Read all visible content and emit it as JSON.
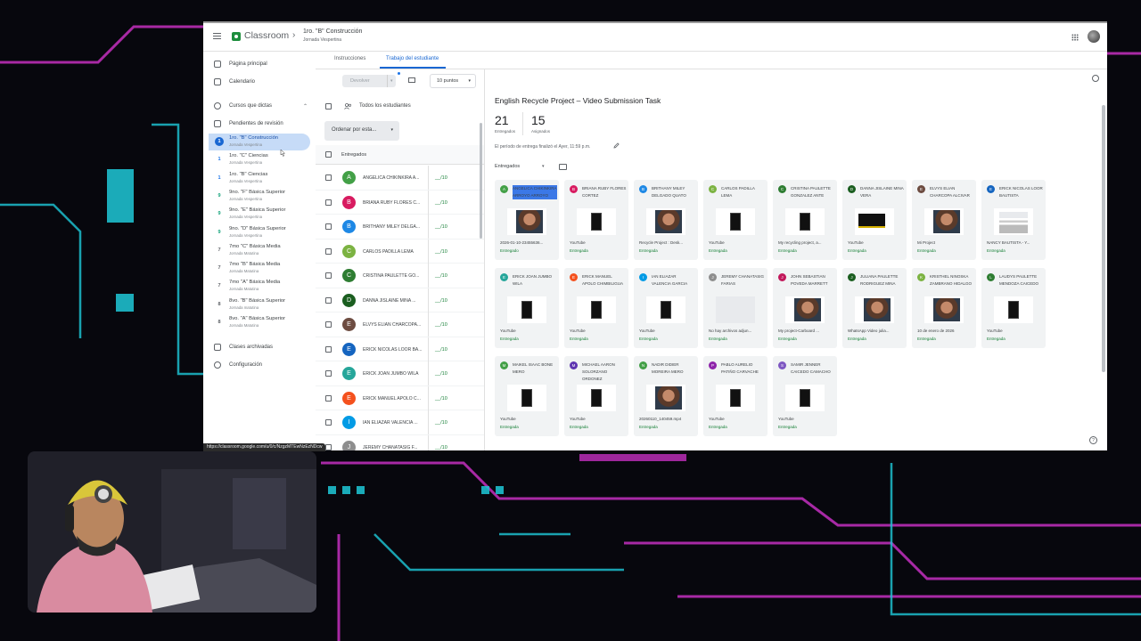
{
  "header": {
    "app_name": "Classroom",
    "course_title": "1ro. \"B\" Construcción",
    "course_subtitle": "Jornada Vespertina"
  },
  "sidebar": {
    "main_items": [
      {
        "label": "Página principal",
        "icon": "home-icon"
      },
      {
        "label": "Calendario",
        "icon": "calendar-icon"
      }
    ],
    "teaching_label": "Cursos que dictas",
    "review_label": "Pendientes de revisión",
    "courses": [
      {
        "num": "1",
        "name": "1ro. \"B\" Construcción",
        "sub": "Jornada Vespertina",
        "color": "#1a73e8"
      },
      {
        "num": "1",
        "name": "1ro. \"C\" Ciencias",
        "sub": "Jornada Vespertina",
        "color": "#1a73e8"
      },
      {
        "num": "1",
        "name": "1ro. \"B\" Ciencias",
        "sub": "Jornada Vespertina",
        "color": "#1a73e8"
      },
      {
        "num": "9",
        "name": "9no. \"F\" Básica Superior",
        "sub": "Jornada Vespertina",
        "color": "#12a37a"
      },
      {
        "num": "9",
        "name": "9no. \"E\" Básica Superior",
        "sub": "Jornada Vespertina",
        "color": "#12a37a"
      },
      {
        "num": "9",
        "name": "9no. \"D\" Básica Superior",
        "sub": "Jornada Vespertina",
        "color": "#12a37a"
      },
      {
        "num": "7",
        "name": "7mo \"C\" Básica Media",
        "sub": "Jornada Matutina",
        "color": "#5f6368"
      },
      {
        "num": "7",
        "name": "7mo \"B\" Básica Media",
        "sub": "Jornada Matutina",
        "color": "#5f6368"
      },
      {
        "num": "7",
        "name": "7mo \"A\" Básica Media",
        "sub": "Jornada Matutina",
        "color": "#5f6368"
      },
      {
        "num": "8",
        "name": "8vo. \"B\" Básica Superior",
        "sub": "Jornada matutina",
        "color": "#5f6368"
      },
      {
        "num": "8",
        "name": "8vo. \"A\" Básica Superior",
        "sub": "Jornada Matutina",
        "color": "#5f6368"
      }
    ],
    "archived_label": "Clases archivadas",
    "settings_label": "Configuración"
  },
  "tabs": [
    {
      "label": "Instrucciones"
    },
    {
      "label": "Trabajo del estudiante"
    }
  ],
  "toolbar": {
    "return_label": "Devolver",
    "points_label": "10 puntos"
  },
  "student_list": {
    "all_students_label": "Todos los estudiantes",
    "sort_label": "Ordenar por esta...",
    "section_label": "Entregados",
    "grade_placeholder": "__/10",
    "students": [
      {
        "initial": "A",
        "name": "ANGELICA CHIKINKIRA A...",
        "color": "#43a047"
      },
      {
        "initial": "B",
        "name": "BRIANA RUBY FLORES C...",
        "color": "#d81b60"
      },
      {
        "initial": "B",
        "name": "BRITHANY MILEY DELGA...",
        "color": "#1e88e5"
      },
      {
        "initial": "C",
        "name": "CARLOS PADILLA LEMA",
        "color": "#7cb342"
      },
      {
        "initial": "C",
        "name": "CRISTINA PAULETTE GO...",
        "color": "#2e7d32"
      },
      {
        "initial": "D",
        "name": "DANNA JISLAINE MINA ...",
        "color": "#1b5e20"
      },
      {
        "initial": "E",
        "name": "ELVYS ELIAN CHARCOPA...",
        "color": "#6d4c41"
      },
      {
        "initial": "E",
        "name": "ERICK NICOLAS LOOR BA...",
        "color": "#1565c0"
      },
      {
        "initial": "E",
        "name": "ERICK JOAN JUMBO WILA",
        "color": "#26a69a"
      },
      {
        "initial": "E",
        "name": "ERICK MANUEL APOLO C...",
        "color": "#f4511e"
      },
      {
        "initial": "I",
        "name": "IAN ELIAZAR VALENCIA ...",
        "color": "#039be5"
      },
      {
        "initial": "J",
        "name": "JEREMY CHANATASIG F...",
        "color": "#8e8e8e"
      }
    ]
  },
  "assignment": {
    "title": "English Recycle Project – Video Submission Task",
    "submitted_count": "21",
    "submitted_label": "Entregados",
    "assigned_count": "15",
    "assigned_label": "Asignados",
    "deadline_text": "El período de entrega finalizó el Ayer, 11:59 p.m.",
    "filter_label": "Entregados"
  },
  "submissions": [
    {
      "initial": "A",
      "name": "ANGELICA CHIKINKIRA ARROYO ARROYO",
      "file": "2026-01-10-23455636...",
      "status": "Entregado",
      "color": "#43a047",
      "thumb": "photo"
    },
    {
      "initial": "B",
      "name": "BRIANA RUBY FLORES CORTEZ",
      "file": "YouTube",
      "status": "Entregada",
      "color": "#d81b60",
      "thumb": "phone"
    },
    {
      "initial": "B",
      "name": "BRITHANY MILEY DELGADO QUATO",
      "file": "Recycle Project : Desk...",
      "status": "Entregada",
      "color": "#1e88e5",
      "thumb": "photo"
    },
    {
      "initial": "C",
      "name": "CARLOS PADILLA LEMA",
      "file": "YouTube",
      "status": "Entregada",
      "color": "#7cb342",
      "thumb": "phone"
    },
    {
      "initial": "C",
      "name": "CRISTINA PAULETTE GONZALEZ ANTE",
      "file": "My recycling project, a...",
      "status": "Entregada",
      "color": "#2e7d32",
      "thumb": "phone"
    },
    {
      "initial": "D",
      "name": "DANNA JISLAINE MINA VERA",
      "file": "YouTube",
      "status": "Entregada",
      "color": "#1b5e20",
      "thumb": "dark"
    },
    {
      "initial": "E",
      "name": "ELVYS ELIAN CHARCOPA ALCIVAR",
      "file": "Mi Project",
      "status": "Entregada",
      "color": "#6d4c41",
      "thumb": "photo"
    },
    {
      "initial": "E",
      "name": "ERICK NICOLAS LOOR BAUTISTA",
      "file": "NANCY BAUTISTA - Y...",
      "status": "Entregada",
      "color": "#1565c0",
      "thumb": "doc"
    },
    {
      "initial": "E",
      "name": "ERICK JOAN JUMBO WILA",
      "file": "YouTube",
      "status": "Entregada",
      "color": "#26a69a",
      "thumb": "phone"
    },
    {
      "initial": "E",
      "name": "ERICK MANUEL APOLO CHIMBILIGUA",
      "file": "YouTube",
      "status": "Entregada",
      "color": "#f4511e",
      "thumb": "phone"
    },
    {
      "initial": "I",
      "name": "IAN ELIAZAR VALENCIA GARCIA",
      "file": "YouTube",
      "status": "Entregada",
      "color": "#039be5",
      "thumb": "phone"
    },
    {
      "initial": "J",
      "name": "JEREMY CHANATASIG FARIAS",
      "file": "No hay archivos adjun...",
      "status": "Entregada",
      "color": "#8e8e8e",
      "thumb": "empty"
    },
    {
      "initial": "J",
      "name": "JOHN SEBASTIAN POVEDA MARRETT",
      "file": "My project-Carboard ...",
      "status": "Entregada",
      "color": "#c2185b",
      "thumb": "photo"
    },
    {
      "initial": "J",
      "name": "JULIANA PAULETTE RODRIGUEZ MINA",
      "file": "WhatsApp Video julia...",
      "status": "Entregada",
      "color": "#1b5e20",
      "thumb": "photo"
    },
    {
      "initial": "K",
      "name": "KRISTHEL NINOSKA ZAMBRANO HIDALGO",
      "file": "10 de enero de 2026",
      "status": "Entregada",
      "color": "#7cb342",
      "thumb": "photo"
    },
    {
      "initial": "L",
      "name": "LAUDYS PAULETTE MENDOZA CAICEDO",
      "file": "YouTube",
      "status": "Entregada",
      "color": "#2e7d32",
      "thumb": "phone"
    },
    {
      "initial": "M",
      "name": "MAIKEL ISAAC BONE MERO",
      "file": "YouTube",
      "status": "Entregada",
      "color": "#43a047",
      "thumb": "phone"
    },
    {
      "initial": "M",
      "name": "MICHAEL AARON SOLORZANO ORDONEZ",
      "file": "YouTube",
      "status": "Entregada",
      "color": "#5e35b1",
      "thumb": "phone"
    },
    {
      "initial": "N",
      "name": "NADIR DIDIER MOREIRA MERO",
      "file": "20260110_140459.mp4",
      "status": "Entregada",
      "color": "#43a047",
      "thumb": "photo"
    },
    {
      "initial": "P",
      "name": "PABLO AURELIO PATIÑO CARVACHE",
      "file": "YouTube",
      "status": "Entregada",
      "color": "#8e24aa",
      "thumb": "phone"
    },
    {
      "initial": "S",
      "name": "SAMIR JENNER CAICEDO CAMACHO",
      "file": "YouTube",
      "status": "Entregada",
      "color": "#7e57c2",
      "thumb": "phone"
    }
  ],
  "browser_status": "https://classroom.google.com/u/0/c/NzgzMTEwNzEzNDcw",
  "colors": {
    "accent": "#1967d2",
    "brand": "#1e8e3e",
    "submitted": "#188038",
    "background_neon_pink": "#e233d6",
    "background_neon_cyan": "#1ec8d8"
  }
}
